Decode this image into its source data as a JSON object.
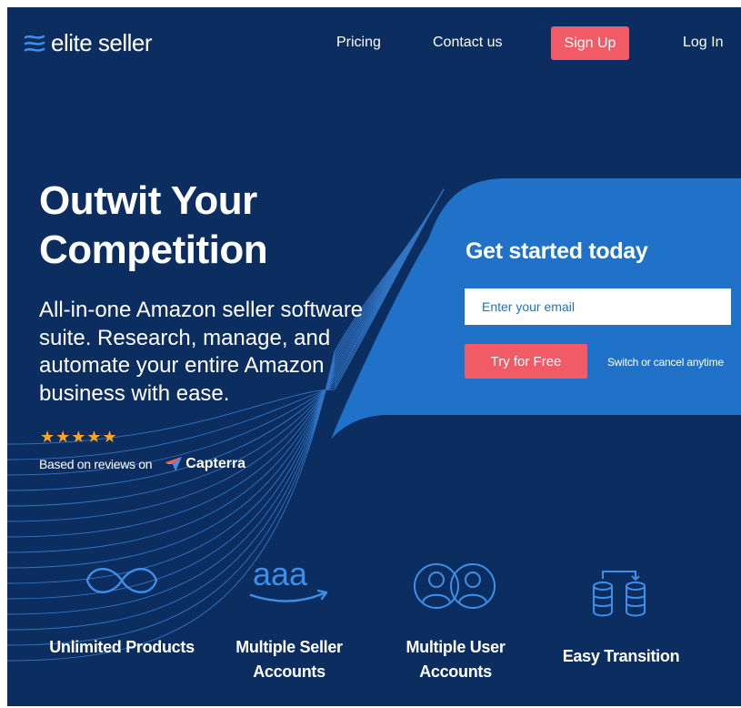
{
  "brand": {
    "name": "elite seller",
    "icon": "elite-seller-logo-mark"
  },
  "nav": {
    "pricing": "Pricing",
    "contact": "Contact us",
    "signup": "Sign Up",
    "login": "Log In"
  },
  "hero": {
    "headline_line1": "Outwit Your",
    "headline_line2": "Competition",
    "subhead": "All-in-one Amazon seller software suite. Research, manage, and automate your entire Amazon business with ease.",
    "stars": "★★★★★",
    "reviews_text": "Based on reviews on",
    "reviews_source": "Capterra"
  },
  "signup_card": {
    "title": "Get started today",
    "email_placeholder": "Enter your email",
    "cta": "Try for Free",
    "note": "Switch or cancel anytime"
  },
  "features": [
    {
      "icon": "infinity-icon",
      "line1": "Unlimited Products",
      "line2": ""
    },
    {
      "icon": "amazon-aaa-icon",
      "line1": "Multiple Seller",
      "line2": "Accounts",
      "glyph": "aaa"
    },
    {
      "icon": "users-icon",
      "line1": "Multiple User",
      "line2": "Accounts"
    },
    {
      "icon": "database-transfer-icon",
      "line1": "Easy Transition",
      "line2": ""
    }
  ],
  "colors": {
    "background": "#0b2d5f",
    "card": "#1f72c7",
    "accent": "#f15b66",
    "icon_line": "#3f8ee8",
    "stars": "#f6a623"
  }
}
